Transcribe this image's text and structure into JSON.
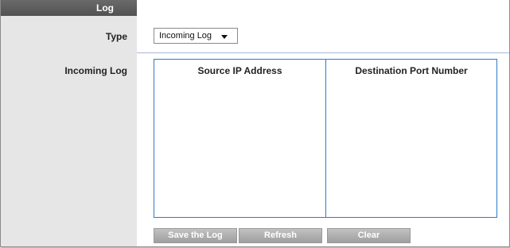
{
  "sidebar": {
    "header_title": "Log",
    "type_label": "Type",
    "incoming_log_label": "Incoming Log"
  },
  "type_select": {
    "selected": "Incoming Log"
  },
  "log_table": {
    "columns": [
      "Source IP Address",
      "Destination Port Number"
    ],
    "rows": []
  },
  "buttons": {
    "save": "Save the Log",
    "refresh": "Refresh",
    "clear": "Clear"
  },
  "colors": {
    "header_bg": "#5a5a5a",
    "sidebar_bg": "#e6e6e6",
    "table_border": "#2f7ac8",
    "button_bg": "#aaaaaa"
  }
}
